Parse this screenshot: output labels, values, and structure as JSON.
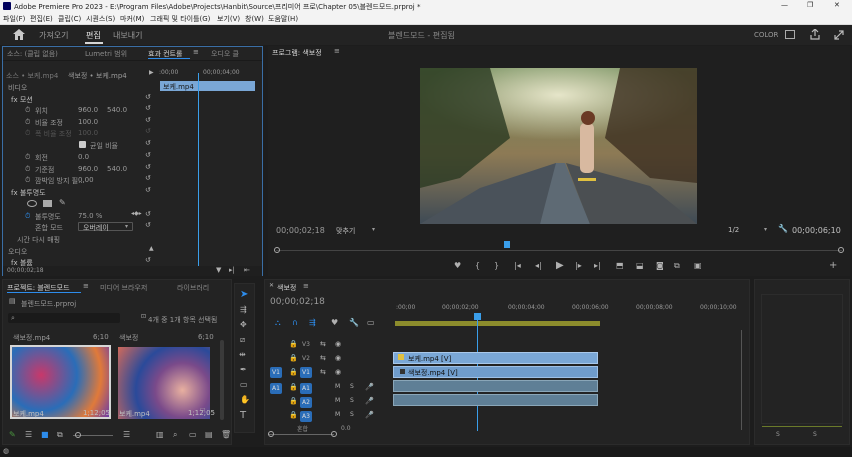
{
  "window": {
    "title": "Adobe Premiere Pro 2023 - E:\\Program Files\\Adobe\\Projects\\Hanbit\\Source\\프리미어 프로\\Chapter 05\\블렌드모드.prproj *",
    "min": "—",
    "max": "❐",
    "close": "✕"
  },
  "menu": [
    "파일(F)",
    "편집(E)",
    "클립(C)",
    "시퀀스(S)",
    "마커(M)",
    "그래픽 및 타이틀(G)",
    "보기(V)",
    "창(W)",
    "도움말(H)"
  ],
  "workspace": {
    "tabs": [
      "가져오기",
      "편집",
      "내보내기"
    ],
    "active_tab": "편집",
    "center_title": "블렌드모드 - 편집됨",
    "color_label": "COLOR"
  },
  "effect_controls": {
    "tabs": [
      "소스: (클립 없음)",
      "Lumetri 범위",
      "효과 컨트롤",
      "오디오 클"
    ],
    "source_line": "소스 • 보케.mp4",
    "seq_line": "색보정 • 보케.mp4",
    "mini_time": ":00;00",
    "mini_time2": "00;00;04;00",
    "clip_bar": "보케.mp4",
    "video_label": "비디오",
    "rows": [
      {
        "label": "fx 모션",
        "v1": "",
        "v2": ""
      },
      {
        "label": "위치",
        "v1": "960.0",
        "v2": "540.0"
      },
      {
        "label": "비율 조정",
        "v1": "100.0",
        "v2": ""
      },
      {
        "label": "폭 비율 조정",
        "v1": "100.0",
        "v2": ""
      },
      {
        "label": "균일 비율",
        "v1": "",
        "v2": ""
      },
      {
        "label": "회전",
        "v1": "0.0",
        "v2": ""
      },
      {
        "label": "기준점",
        "v1": "960.0",
        "v2": "540.0"
      },
      {
        "label": "깜박임 방지 필...",
        "v1": "0.00",
        "v2": ""
      },
      {
        "label": "fx 불투명도",
        "v1": "",
        "v2": ""
      },
      {
        "label": "불투명도",
        "v1": "75.0 %",
        "v2": ""
      },
      {
        "label": "혼합 모드",
        "v1": "오버레이",
        "v2": ""
      },
      {
        "label": "시간 다시 매핑",
        "v1": "",
        "v2": ""
      }
    ],
    "audio_label": "오디오",
    "volume_label": "fx 볼륨",
    "footer_time": "00;00;02;18"
  },
  "program": {
    "title": "프로그램: 색보정",
    "timecode": "00;00;02;18",
    "fit": "맞추기",
    "resolution": "1/2",
    "duration": "00;00;06;10"
  },
  "project": {
    "tabs": [
      "프로젝트: 블렌드모드",
      "미디어 브라우저",
      "라이브러리"
    ],
    "file": "블렌드모드.prproj",
    "selection_info": "4개 중 1개 항목 선택됨",
    "items": [
      {
        "top_label": "색보정.mp4",
        "top_dur": "6;10",
        "name": "보케.mp4",
        "dur": "1;12;05"
      },
      {
        "top_label": "색보정",
        "top_dur": "6;10",
        "name": "보케.mp4",
        "dur": "1;12;05"
      }
    ]
  },
  "timeline": {
    "title": "색보정",
    "timecode": "00;00;02;18",
    "ruler": [
      ":00;00",
      "00;00;02;00",
      "00;00;04;00",
      "00;00;06;00",
      "00;00;08;00",
      "00;00;10;00"
    ],
    "tracks": [
      {
        "label": "V3",
        "src": ""
      },
      {
        "label": "V2",
        "src": ""
      },
      {
        "label": "V1",
        "src": "V1"
      },
      {
        "label": "A1",
        "src": "A1"
      },
      {
        "label": "A2",
        "src": ""
      },
      {
        "label": "A3",
        "src": ""
      }
    ],
    "mix_label": "혼합",
    "mix_value": "0.0",
    "clips": [
      {
        "track": "V2",
        "name": "보케.mp4 [V]"
      },
      {
        "track": "V1",
        "name": "색보정.mp4 [V]"
      }
    ]
  },
  "meter": {
    "labels": [
      "S",
      "S"
    ]
  },
  "colors": {
    "accent": "#2d8ceb",
    "clip_video": "#7aa7d6",
    "clip_audio": "#6b8fa8",
    "playhead": "#3a9eea"
  }
}
